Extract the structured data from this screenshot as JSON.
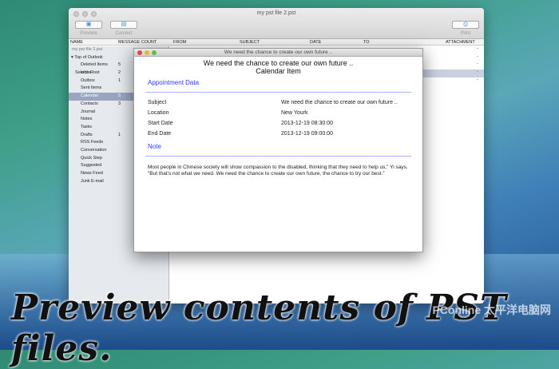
{
  "window": {
    "title": "my pst file 2.pst",
    "toolbar": {
      "preview": "Preview",
      "convert": "Convert",
      "print": "Print"
    },
    "columns": {
      "name": "NAME",
      "message_count": "MESSAGE COUNT",
      "from": "FROM",
      "subject": "SUBJECT",
      "date": "DATE",
      "to": "TO",
      "attachment": "ATTACHMENT"
    }
  },
  "sidebar": {
    "root": "my pst file 2.pst",
    "top": "▾ Top of Outlook",
    "items": [
      {
        "label": "Deleted Items",
        "count": "5"
      },
      {
        "label": "Inbox",
        "count": "2"
      },
      {
        "label": "Outbox",
        "count": "1"
      },
      {
        "label": "Sent Items",
        "count": ""
      },
      {
        "label": "Calendar",
        "count": "5"
      },
      {
        "label": "Contacts",
        "count": "3"
      },
      {
        "label": "Journal",
        "count": ""
      },
      {
        "label": "Notes",
        "count": ""
      },
      {
        "label": "Tasks",
        "count": ""
      },
      {
        "label": "Drafts",
        "count": "1"
      },
      {
        "label": "RSS Feeds",
        "count": ""
      },
      {
        "label": "Conversation",
        "count": ""
      },
      {
        "label": "Quick Step",
        "count": ""
      },
      {
        "label": "Suggested",
        "count": ""
      },
      {
        "label": "News Feed",
        "count": ""
      },
      {
        "label": "Junk E-mail",
        "count": ""
      }
    ],
    "search_root": "Search Root"
  },
  "list": {
    "attachments": [
      "-",
      "-",
      "-",
      "-",
      "-"
    ]
  },
  "dialog": {
    "title": "We need the chance to create our own future ..",
    "heading": "We need the chance to create our own future ..",
    "subheading": "Calendar Item",
    "section1": "Appointment Data",
    "fields": [
      {
        "k": "Subject",
        "v": "We need the chance to create our own future .."
      },
      {
        "k": "Location",
        "v": "New Yourk"
      },
      {
        "k": "Start Date",
        "v": "2013-12-19 08:30:00"
      },
      {
        "k": "End Date",
        "v": "2013-12-19 09:00:00"
      }
    ],
    "section2": "Note",
    "note": "Most people in Chinese society will show compassion to the disabled, thinking that they need to help us,\" Yi says. \"But that's not what we need. We need the chance to create our own future, the chance to try our best.\""
  },
  "caption": "Preview contents of PST files.",
  "watermark": "PConline 太平洋电脑网"
}
